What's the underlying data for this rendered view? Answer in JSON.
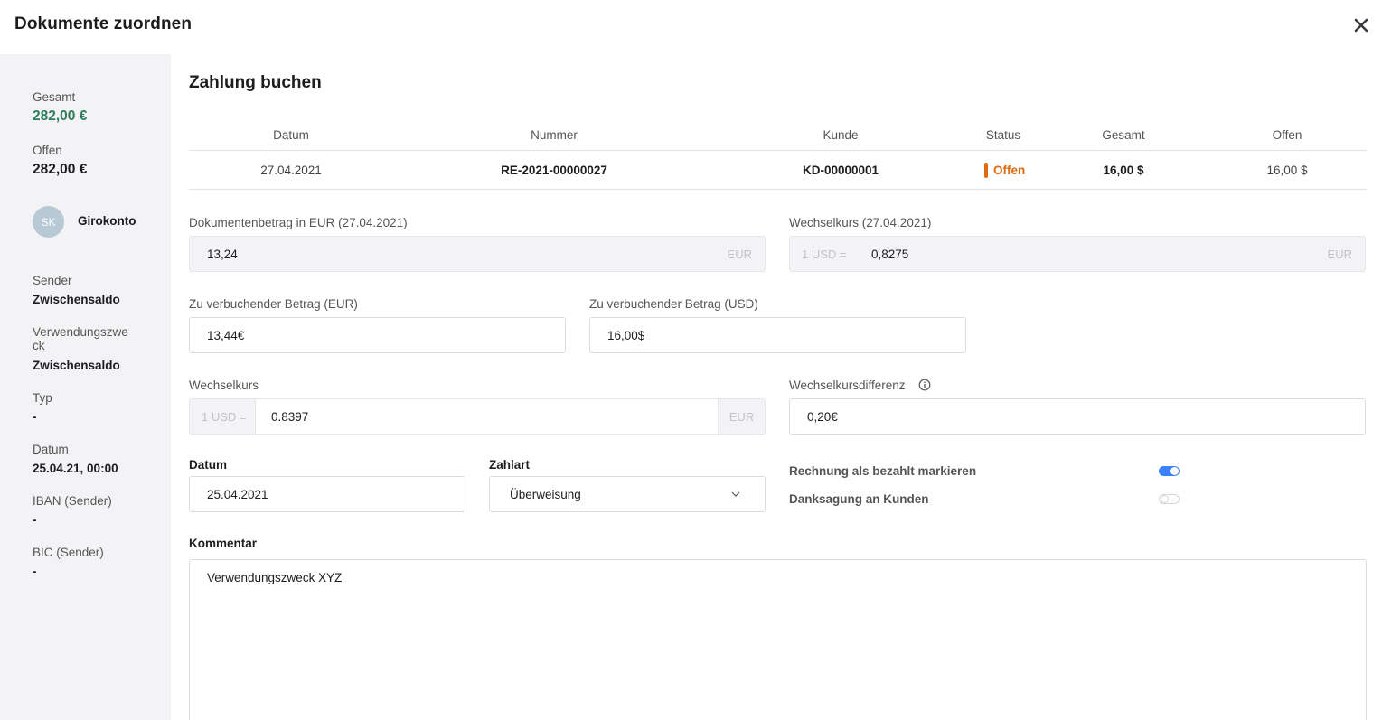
{
  "modal": {
    "title": "Dokumente zuordnen"
  },
  "sidebar": {
    "total_label": "Gesamt",
    "total_value": "282,00 €",
    "open_label": "Offen",
    "open_value": "282,00 €",
    "avatar_initials": "SK",
    "account_name": "Girokonto",
    "details": [
      {
        "label": "Sender",
        "value": "Zwischensaldo"
      },
      {
        "label": "Verwendungszwe\nck",
        "value": "Zwischensaldo"
      },
      {
        "label": "Typ",
        "value": "-"
      },
      {
        "label": "Datum",
        "value": "25.04.21, 00:00"
      },
      {
        "label": "IBAN (Sender)",
        "value": "-"
      },
      {
        "label": "BIC (Sender)",
        "value": "-"
      }
    ]
  },
  "main": {
    "title": "Zahlung buchen",
    "table": {
      "headers": [
        "Datum",
        "Nummer",
        "Kunde",
        "Status",
        "Gesamt",
        "Offen"
      ],
      "row": {
        "datum": "27.04.2021",
        "nummer": "RE-2021-00000027",
        "kunde": "KD-00000001",
        "status": "Offen",
        "gesamt": "16,00 $",
        "offen": "16,00 $"
      }
    },
    "doc_amount": {
      "label": "Dokumentenbetrag in EUR (27.04.2021)",
      "value": "13,24",
      "suffix": "EUR"
    },
    "rate_doc": {
      "label": "Wechselkurs (27.04.2021)",
      "prefix": "1 USD =",
      "value": "0,8275",
      "suffix": "EUR"
    },
    "book_eur": {
      "label": "Zu verbuchender Betrag (EUR)",
      "value": "13,44€"
    },
    "book_usd": {
      "label": "Zu verbuchender Betrag (USD)",
      "value": "16,00$"
    },
    "rate": {
      "label": "Wechselkurs",
      "prefix": "1 USD =",
      "value": "0.8397",
      "suffix": "EUR"
    },
    "rate_diff": {
      "label": "Wechselkursdifferenz",
      "value": "0,20€"
    },
    "date": {
      "label": "Datum",
      "value": "25.04.2021"
    },
    "payment_type": {
      "label": "Zahlart",
      "value": "Überweisung"
    },
    "toggles": [
      {
        "label": "Rechnung als bezahlt markieren",
        "on": true
      },
      {
        "label": "Danksagung an Kunden",
        "on": false
      }
    ],
    "comment": {
      "label": "Kommentar",
      "value": "Verwendungszweck XYZ"
    }
  },
  "colors": {
    "accent_green": "#2e7d5b",
    "status_orange": "#e06a10",
    "toggle_blue": "#3b82f6",
    "sidebar_bg": "#f3f3f5"
  }
}
